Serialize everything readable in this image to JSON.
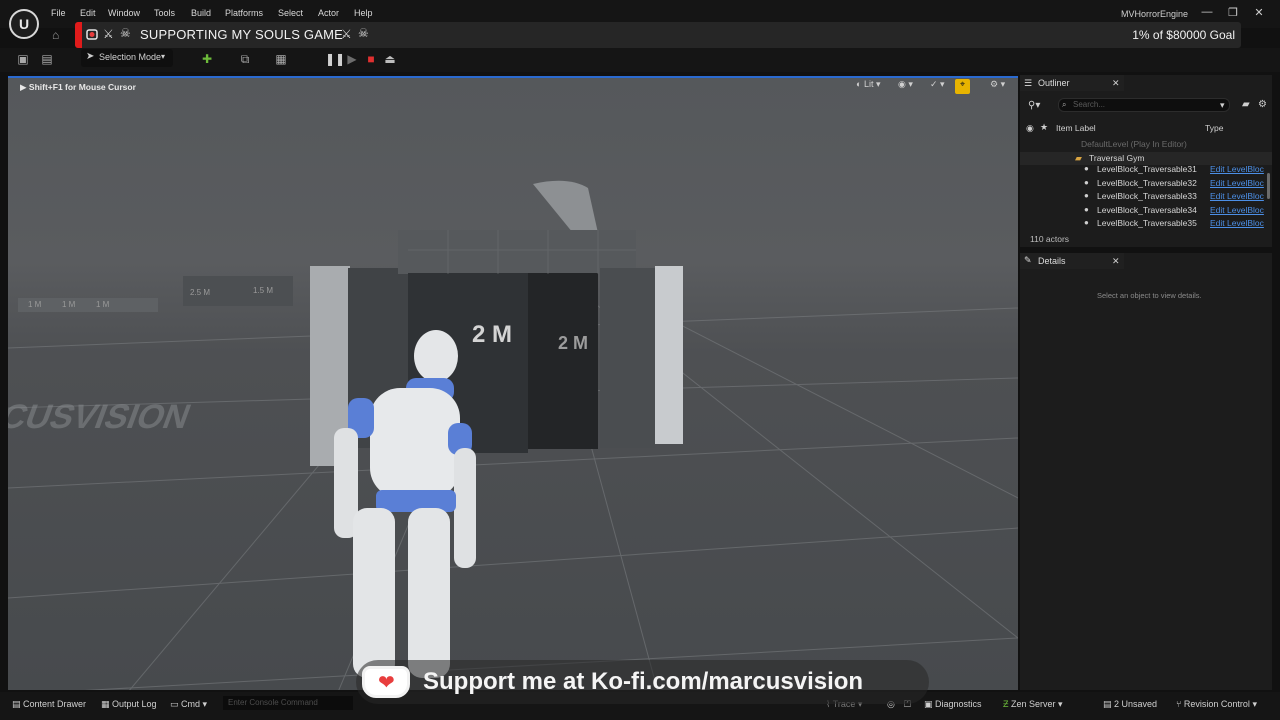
{
  "menubar": {
    "items": [
      "File",
      "Edit",
      "Window",
      "Tools",
      "Build",
      "Platforms",
      "Select",
      "Actor",
      "Help"
    ],
    "project": "MVHorrorEngine",
    "window_controls": [
      "—",
      "❐",
      "✕"
    ]
  },
  "banner": {
    "title": "SUPPORTING MY SOULS GAME",
    "goal": "1% of $80000 Goal"
  },
  "toolbar": {
    "selection_mode": "Selection Mode"
  },
  "viewport": {
    "hint": "Shift+F1 for Mouse Cursor",
    "lit_label": "Lit",
    "wall_label_front": "2 M",
    "wall_label_side": "2 M",
    "floor_labels": [
      "1 M",
      "1 M",
      "1 M",
      "2.5 M",
      "1.5 M"
    ],
    "floor_text": "MARCUSVISION"
  },
  "outliner": {
    "tab_label": "Outliner",
    "search_placeholder": "Search...",
    "columns": {
      "label": "Item Label",
      "type": "Type"
    },
    "rows": [
      {
        "label": "DefaultLevel (Play In Editor)",
        "type": ""
      },
      {
        "label": "Traversal Gym",
        "type": ""
      },
      {
        "label": "LevelBlock_Traversable31",
        "type": "Edit LevelBloc"
      },
      {
        "label": "LevelBlock_Traversable32",
        "type": "Edit LevelBloc"
      },
      {
        "label": "LevelBlock_Traversable33",
        "type": "Edit LevelBloc"
      },
      {
        "label": "LevelBlock_Traversable34",
        "type": "Edit LevelBloc"
      },
      {
        "label": "LevelBlock_Traversable35",
        "type": "Edit LevelBloc"
      }
    ],
    "count": "110 actors"
  },
  "details": {
    "tab_label": "Details",
    "empty_text": "Select an object to view details."
  },
  "statusbar": {
    "content_drawer": "Content Drawer",
    "output_log": "Output Log",
    "cmd": "Cmd",
    "console_placeholder": "Enter Console Command",
    "trace": "Trace",
    "diagnostics": "Diagnostics",
    "zen_server": "Zen Server",
    "unsaved": "2 Unsaved",
    "revision_control": "Revision Control"
  },
  "kofi": {
    "text": "Support me at Ko-fi.com/marcusvision"
  },
  "colors": {
    "banner_accent": "#e01b1b",
    "link": "#4c8fe6",
    "viewport_border": "#2a6ad0",
    "snap_active": "#e8b400"
  }
}
